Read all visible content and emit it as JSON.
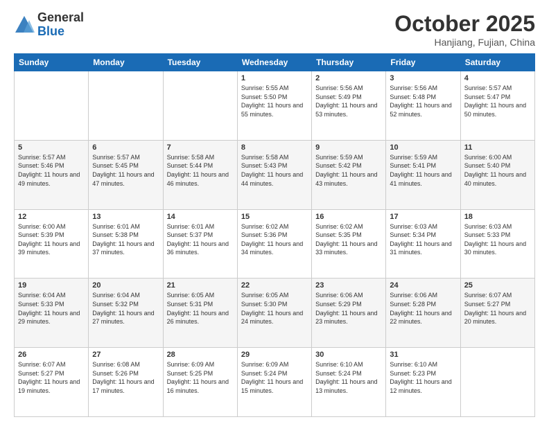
{
  "header": {
    "logo_general": "General",
    "logo_blue": "Blue",
    "month_title": "October 2025",
    "location": "Hanjiang, Fujian, China"
  },
  "weekdays": [
    "Sunday",
    "Monday",
    "Tuesday",
    "Wednesday",
    "Thursday",
    "Friday",
    "Saturday"
  ],
  "weeks": [
    [
      {
        "day": "",
        "sunrise": "",
        "sunset": "",
        "daylight": ""
      },
      {
        "day": "",
        "sunrise": "",
        "sunset": "",
        "daylight": ""
      },
      {
        "day": "",
        "sunrise": "",
        "sunset": "",
        "daylight": ""
      },
      {
        "day": "1",
        "sunrise": "Sunrise: 5:55 AM",
        "sunset": "Sunset: 5:50 PM",
        "daylight": "Daylight: 11 hours and 55 minutes."
      },
      {
        "day": "2",
        "sunrise": "Sunrise: 5:56 AM",
        "sunset": "Sunset: 5:49 PM",
        "daylight": "Daylight: 11 hours and 53 minutes."
      },
      {
        "day": "3",
        "sunrise": "Sunrise: 5:56 AM",
        "sunset": "Sunset: 5:48 PM",
        "daylight": "Daylight: 11 hours and 52 minutes."
      },
      {
        "day": "4",
        "sunrise": "Sunrise: 5:57 AM",
        "sunset": "Sunset: 5:47 PM",
        "daylight": "Daylight: 11 hours and 50 minutes."
      }
    ],
    [
      {
        "day": "5",
        "sunrise": "Sunrise: 5:57 AM",
        "sunset": "Sunset: 5:46 PM",
        "daylight": "Daylight: 11 hours and 49 minutes."
      },
      {
        "day": "6",
        "sunrise": "Sunrise: 5:57 AM",
        "sunset": "Sunset: 5:45 PM",
        "daylight": "Daylight: 11 hours and 47 minutes."
      },
      {
        "day": "7",
        "sunrise": "Sunrise: 5:58 AM",
        "sunset": "Sunset: 5:44 PM",
        "daylight": "Daylight: 11 hours and 46 minutes."
      },
      {
        "day": "8",
        "sunrise": "Sunrise: 5:58 AM",
        "sunset": "Sunset: 5:43 PM",
        "daylight": "Daylight: 11 hours and 44 minutes."
      },
      {
        "day": "9",
        "sunrise": "Sunrise: 5:59 AM",
        "sunset": "Sunset: 5:42 PM",
        "daylight": "Daylight: 11 hours and 43 minutes."
      },
      {
        "day": "10",
        "sunrise": "Sunrise: 5:59 AM",
        "sunset": "Sunset: 5:41 PM",
        "daylight": "Daylight: 11 hours and 41 minutes."
      },
      {
        "day": "11",
        "sunrise": "Sunrise: 6:00 AM",
        "sunset": "Sunset: 5:40 PM",
        "daylight": "Daylight: 11 hours and 40 minutes."
      }
    ],
    [
      {
        "day": "12",
        "sunrise": "Sunrise: 6:00 AM",
        "sunset": "Sunset: 5:39 PM",
        "daylight": "Daylight: 11 hours and 39 minutes."
      },
      {
        "day": "13",
        "sunrise": "Sunrise: 6:01 AM",
        "sunset": "Sunset: 5:38 PM",
        "daylight": "Daylight: 11 hours and 37 minutes."
      },
      {
        "day": "14",
        "sunrise": "Sunrise: 6:01 AM",
        "sunset": "Sunset: 5:37 PM",
        "daylight": "Daylight: 11 hours and 36 minutes."
      },
      {
        "day": "15",
        "sunrise": "Sunrise: 6:02 AM",
        "sunset": "Sunset: 5:36 PM",
        "daylight": "Daylight: 11 hours and 34 minutes."
      },
      {
        "day": "16",
        "sunrise": "Sunrise: 6:02 AM",
        "sunset": "Sunset: 5:35 PM",
        "daylight": "Daylight: 11 hours and 33 minutes."
      },
      {
        "day": "17",
        "sunrise": "Sunrise: 6:03 AM",
        "sunset": "Sunset: 5:34 PM",
        "daylight": "Daylight: 11 hours and 31 minutes."
      },
      {
        "day": "18",
        "sunrise": "Sunrise: 6:03 AM",
        "sunset": "Sunset: 5:33 PM",
        "daylight": "Daylight: 11 hours and 30 minutes."
      }
    ],
    [
      {
        "day": "19",
        "sunrise": "Sunrise: 6:04 AM",
        "sunset": "Sunset: 5:33 PM",
        "daylight": "Daylight: 11 hours and 29 minutes."
      },
      {
        "day": "20",
        "sunrise": "Sunrise: 6:04 AM",
        "sunset": "Sunset: 5:32 PM",
        "daylight": "Daylight: 11 hours and 27 minutes."
      },
      {
        "day": "21",
        "sunrise": "Sunrise: 6:05 AM",
        "sunset": "Sunset: 5:31 PM",
        "daylight": "Daylight: 11 hours and 26 minutes."
      },
      {
        "day": "22",
        "sunrise": "Sunrise: 6:05 AM",
        "sunset": "Sunset: 5:30 PM",
        "daylight": "Daylight: 11 hours and 24 minutes."
      },
      {
        "day": "23",
        "sunrise": "Sunrise: 6:06 AM",
        "sunset": "Sunset: 5:29 PM",
        "daylight": "Daylight: 11 hours and 23 minutes."
      },
      {
        "day": "24",
        "sunrise": "Sunrise: 6:06 AM",
        "sunset": "Sunset: 5:28 PM",
        "daylight": "Daylight: 11 hours and 22 minutes."
      },
      {
        "day": "25",
        "sunrise": "Sunrise: 6:07 AM",
        "sunset": "Sunset: 5:27 PM",
        "daylight": "Daylight: 11 hours and 20 minutes."
      }
    ],
    [
      {
        "day": "26",
        "sunrise": "Sunrise: 6:07 AM",
        "sunset": "Sunset: 5:27 PM",
        "daylight": "Daylight: 11 hours and 19 minutes."
      },
      {
        "day": "27",
        "sunrise": "Sunrise: 6:08 AM",
        "sunset": "Sunset: 5:26 PM",
        "daylight": "Daylight: 11 hours and 17 minutes."
      },
      {
        "day": "28",
        "sunrise": "Sunrise: 6:09 AM",
        "sunset": "Sunset: 5:25 PM",
        "daylight": "Daylight: 11 hours and 16 minutes."
      },
      {
        "day": "29",
        "sunrise": "Sunrise: 6:09 AM",
        "sunset": "Sunset: 5:24 PM",
        "daylight": "Daylight: 11 hours and 15 minutes."
      },
      {
        "day": "30",
        "sunrise": "Sunrise: 6:10 AM",
        "sunset": "Sunset: 5:24 PM",
        "daylight": "Daylight: 11 hours and 13 minutes."
      },
      {
        "day": "31",
        "sunrise": "Sunrise: 6:10 AM",
        "sunset": "Sunset: 5:23 PM",
        "daylight": "Daylight: 11 hours and 12 minutes."
      },
      {
        "day": "",
        "sunrise": "",
        "sunset": "",
        "daylight": ""
      }
    ]
  ]
}
